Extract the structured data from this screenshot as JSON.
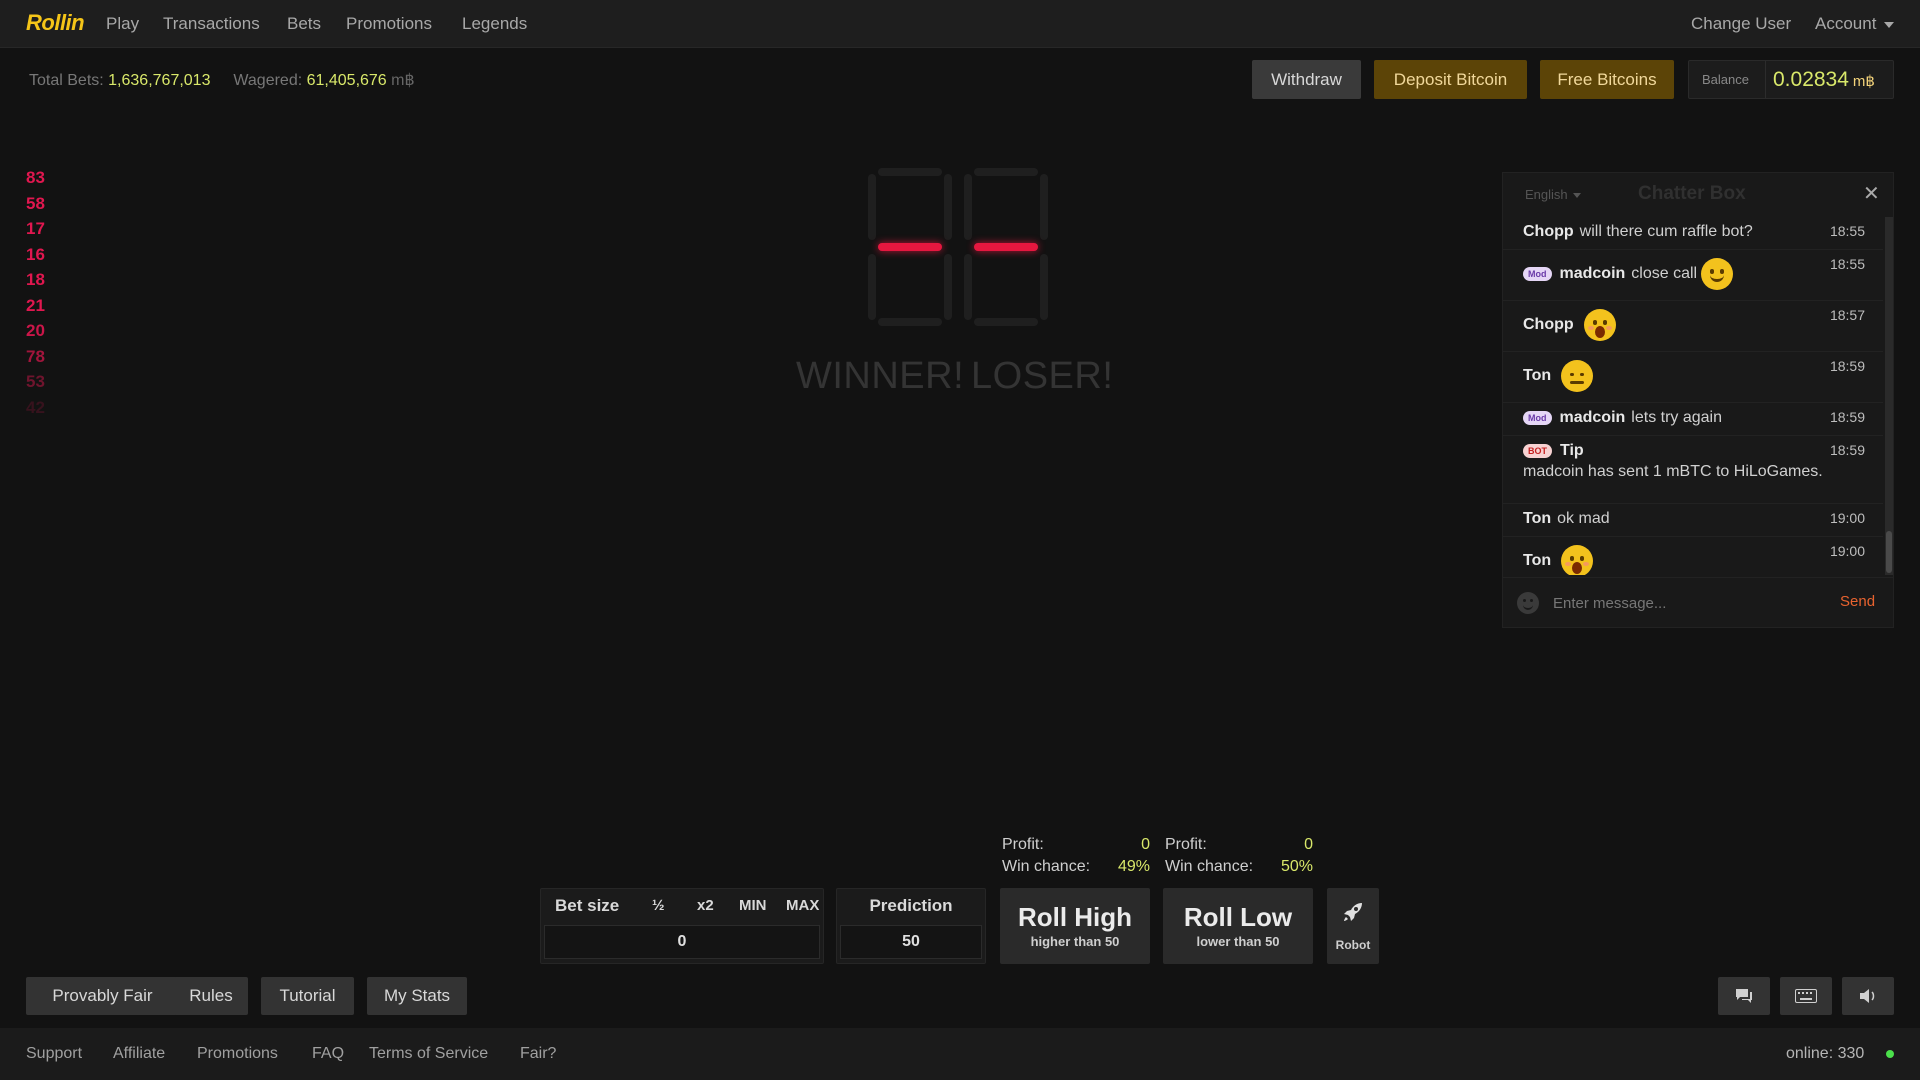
{
  "nav": {
    "logo": "Rollin",
    "items": [
      "Play",
      "Transactions",
      "Bets",
      "Promotions",
      "Legends"
    ],
    "change_user": "Change User",
    "account": "Account"
  },
  "stats": {
    "total_bets_label": "Total Bets:",
    "total_bets": "1,636,767,013",
    "wagered_label": "Wagered:",
    "wagered": "61,405,676",
    "unit": "m฿"
  },
  "actions": {
    "withdraw": "Withdraw",
    "deposit": "Deposit Bitcoin",
    "free": "Free Bitcoins"
  },
  "balance": {
    "label": "Balance",
    "value": "0.02834",
    "unit": "m฿"
  },
  "history": [
    {
      "value": "83",
      "opacity": 1.0
    },
    {
      "value": "58",
      "opacity": 1.0
    },
    {
      "value": "17",
      "opacity": 1.0
    },
    {
      "value": "16",
      "opacity": 1.0
    },
    {
      "value": "18",
      "opacity": 1.0
    },
    {
      "value": "21",
      "opacity": 1.0
    },
    {
      "value": "20",
      "opacity": 0.9
    },
    {
      "value": "78",
      "opacity": 0.7
    },
    {
      "value": "53",
      "opacity": 0.45
    },
    {
      "value": "42",
      "opacity": 0.18
    }
  ],
  "result": {
    "winner": "WINNER!",
    "loser": "LOSER!"
  },
  "chat": {
    "language": "English",
    "title": "Chatter Box",
    "close": "✕",
    "messages": [
      {
        "user": "Chopp",
        "text": "will there cum raffle bot?",
        "time": "18:55",
        "badge": "",
        "emoji": ""
      },
      {
        "user": "madcoin",
        "text": "close call",
        "time": "18:55",
        "badge": "Mod",
        "emoji": "smile"
      },
      {
        "user": "Chopp",
        "text": "",
        "time": "18:57",
        "badge": "",
        "emoji": "surprised"
      },
      {
        "user": "Ton",
        "text": "",
        "time": "18:59",
        "badge": "",
        "emoji": "unamused"
      },
      {
        "user": "madcoin",
        "text": "lets try again",
        "time": "18:59",
        "badge": "Mod",
        "emoji": ""
      },
      {
        "user": "Tip",
        "text": "madcoin has sent 1 mBTC to HiLoGames.",
        "time": "18:59",
        "badge": "BOT",
        "emoji": ""
      },
      {
        "user": "Ton",
        "text": "ok mad",
        "time": "19:00",
        "badge": "",
        "emoji": ""
      },
      {
        "user": "Ton",
        "text": "",
        "time": "19:00",
        "badge": "",
        "emoji": "surprised"
      }
    ],
    "placeholder": "Enter message...",
    "send": "Send"
  },
  "high_info": {
    "profit_label": "Profit:",
    "profit": "0",
    "chance_label": "Win chance:",
    "chance": "49%"
  },
  "low_info": {
    "profit_label": "Profit:",
    "profit": "0",
    "chance_label": "Win chance:",
    "chance": "50%"
  },
  "bet": {
    "label": "Bet size",
    "half": "½",
    "double": "x2",
    "min": "MIN",
    "max": "MAX",
    "value": "0"
  },
  "prediction": {
    "label": "Prediction",
    "value": "50"
  },
  "roll_high": {
    "label": "Roll High",
    "sub": "higher than 50"
  },
  "roll_low": {
    "label": "Roll Low",
    "sub": "lower than 50"
  },
  "robot": {
    "label": "Robot"
  },
  "bottom_tabs": [
    "Provably Fair",
    "Rules",
    "Tutorial",
    "My Stats"
  ],
  "footer": {
    "links": [
      "Support",
      "Affiliate",
      "Promotions",
      "FAQ",
      "Terms of Service",
      "Fair?"
    ],
    "online_label": "online:",
    "online_count": "330"
  },
  "colors": {
    "accent_yellow": "#d9e86a",
    "loss_red": "#e0174f",
    "gold_button": "#5c4407",
    "send_orange": "#e8632f"
  }
}
